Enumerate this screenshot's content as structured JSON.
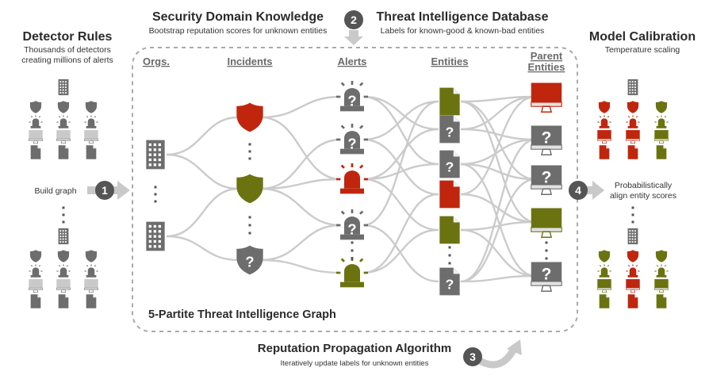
{
  "colors": {
    "bad": "#c0260e",
    "good": "#6b7310",
    "unknown": "#6d6d6d",
    "light": "#c9c9c9",
    "edge": "#cbcbcb"
  },
  "unknown_marker": "?",
  "detector_rules": {
    "title": "Detector Rules",
    "subtitle_1": "Thousands of detectors",
    "subtitle_2": "creating millions of alerts"
  },
  "security_domain": {
    "title": "Security Domain Knowledge",
    "subtitle": "Bootstrap reputation scores for unknown entities"
  },
  "threat_db": {
    "step": "2",
    "title": "Threat Intelligence Database",
    "subtitle": "Labels for known-good & known-bad entities"
  },
  "model_calibration": {
    "title": "Model Calibration",
    "subtitle": "Temperature scaling"
  },
  "build_graph": {
    "step": "1",
    "label": "Build graph"
  },
  "align": {
    "step": "4",
    "label_1": "Probabilistically",
    "label_2": "align entity scores"
  },
  "propagation": {
    "step": "3",
    "title": "Reputation Propagation Algorithm",
    "subtitle": "Iteratively update labels for unknown entities"
  },
  "graph": {
    "title": "5-Partite Threat Intelligence Graph",
    "columns": [
      {
        "header": "Orgs.",
        "type": "building",
        "nodes": [
          "org",
          "org"
        ]
      },
      {
        "header": "Incidents",
        "type": "shield",
        "nodes": [
          "bad",
          "good",
          "unknown"
        ]
      },
      {
        "header": "Alerts",
        "type": "alert",
        "nodes": [
          "unknown",
          "unknown",
          "bad",
          "unknown",
          "good"
        ]
      },
      {
        "header": "Entities",
        "type": "doc",
        "nodes": [
          "good",
          "unknown",
          "unknown",
          "bad",
          "good",
          "unknown"
        ]
      },
      {
        "header_1": "Parent",
        "header_2": "Entities",
        "type": "monitor",
        "nodes": [
          "bad",
          "unknown",
          "unknown",
          "good",
          "unknown"
        ]
      }
    ],
    "edges": [
      [
        [
          0,
          0
        ],
        [
          0,
          1
        ],
        [
          1,
          1
        ],
        [
          1,
          2
        ]
      ],
      [
        [
          0,
          0
        ],
        [
          0,
          2
        ],
        [
          1,
          1
        ],
        [
          1,
          3
        ],
        [
          1,
          2
        ],
        [
          2,
          3
        ],
        [
          2,
          4
        ]
      ],
      [
        [
          0,
          1
        ],
        [
          0,
          2
        ],
        [
          1,
          0
        ],
        [
          1,
          3
        ],
        [
          2,
          2
        ],
        [
          2,
          4
        ],
        [
          2,
          1
        ],
        [
          3,
          0
        ],
        [
          3,
          5
        ],
        [
          4,
          3
        ],
        [
          4,
          4
        ]
      ],
      [
        [
          0,
          0
        ],
        [
          0,
          2
        ],
        [
          0,
          3
        ],
        [
          1,
          0
        ],
        [
          1,
          1
        ],
        [
          2,
          1
        ],
        [
          2,
          2
        ],
        [
          2,
          4
        ],
        [
          3,
          0
        ],
        [
          3,
          3
        ],
        [
          4,
          3
        ],
        [
          4,
          4
        ],
        [
          5,
          1
        ],
        [
          5,
          4
        ],
        [
          5,
          2
        ]
      ]
    ]
  },
  "left_groups": [
    [
      "unknown",
      "unknown",
      "unknown"
    ],
    [
      "unknown",
      "unknown",
      "unknown"
    ]
  ],
  "right_groups": [
    [
      "bad",
      "bad",
      "good"
    ],
    [
      "good",
      "bad",
      "good"
    ]
  ]
}
